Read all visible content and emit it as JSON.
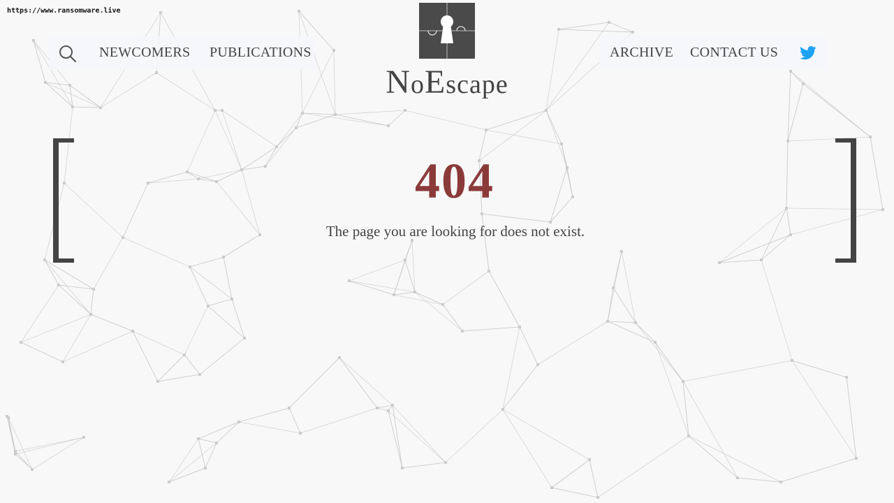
{
  "url_label": "https://www.ransomware.live",
  "nav": {
    "left": [
      {
        "label": "NEWCOMERS"
      },
      {
        "label": "PUBLICATIONS"
      }
    ],
    "right": [
      {
        "label": "ARCHIVE"
      },
      {
        "label": "CONTACT US"
      }
    ],
    "icons": {
      "search": "search-icon",
      "twitter": "twitter-icon"
    }
  },
  "brand": {
    "name_prefix_n": "N",
    "name_o": "o",
    "name_e": "E",
    "name_rest": "scape"
  },
  "error": {
    "code": "404",
    "message": "The page you are looking for does not exist."
  },
  "colors": {
    "background": "#f8f8f8",
    "text": "#444444",
    "accent_error": "#8b3a3a",
    "logo_bg": "#4a4a4a",
    "twitter_blue": "#1da1f2"
  }
}
